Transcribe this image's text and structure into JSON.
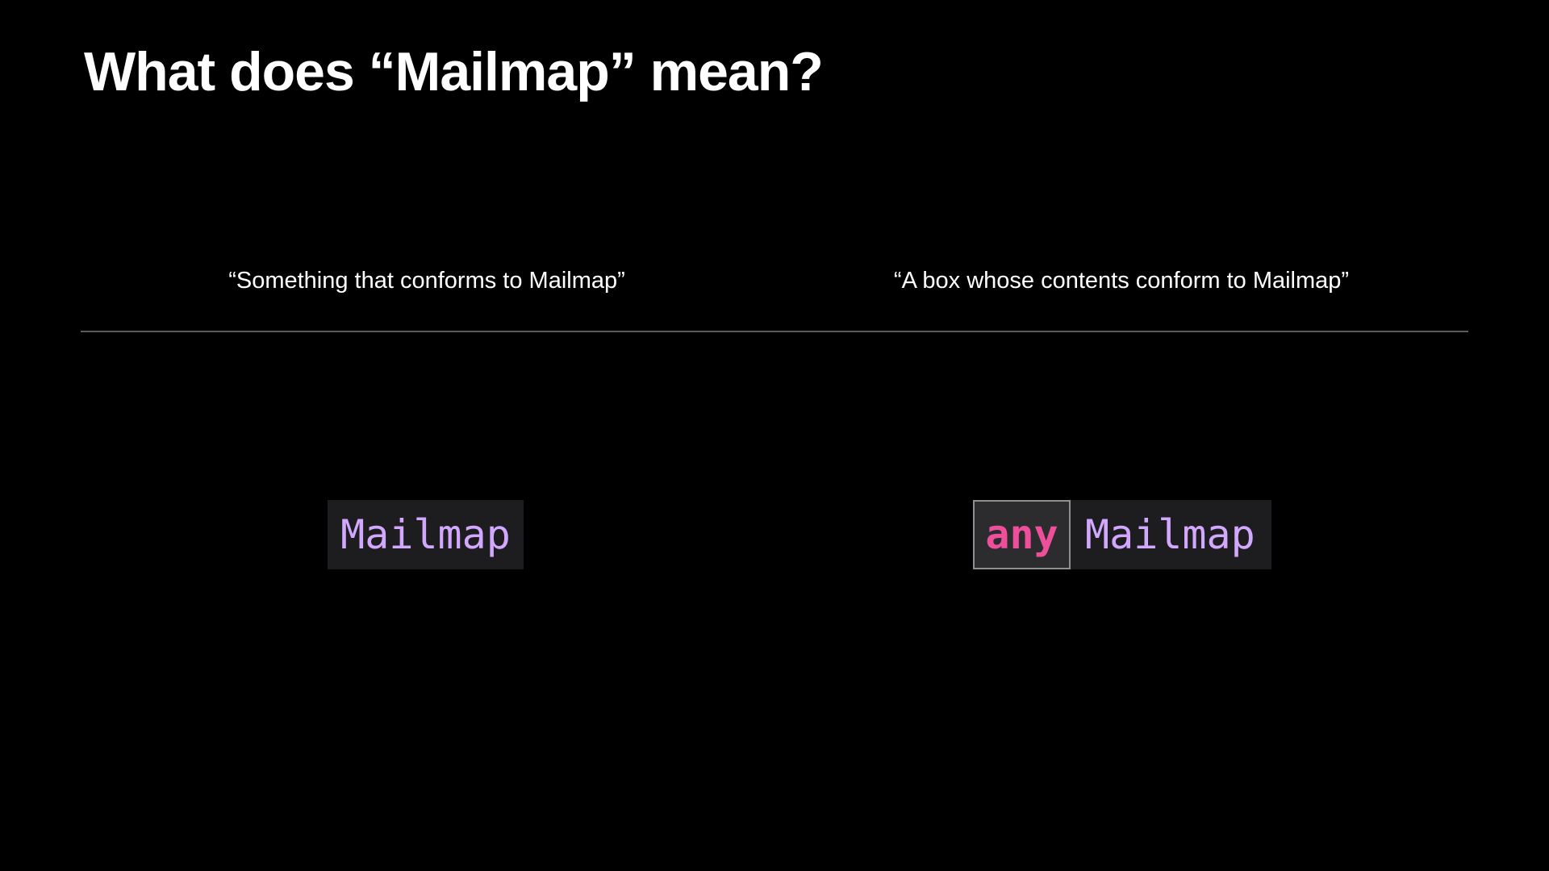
{
  "slide": {
    "title": "What does “Mailmap” mean?",
    "left": {
      "caption": "“Something that conforms to Mailmap”",
      "code": {
        "type_name": "Mailmap"
      }
    },
    "right": {
      "caption": "“A box whose contents conform to Mailmap”",
      "code": {
        "keyword": "any",
        "type_name": "Mailmap"
      }
    }
  },
  "colors": {
    "background": "#000000",
    "text": "#ffffff",
    "divider": "#5c5c5c",
    "code_background": "#1d1d1f",
    "type_name": "#d2a8ff",
    "keyword": "#ee4f9a",
    "keyword_border": "#8e8e93"
  }
}
